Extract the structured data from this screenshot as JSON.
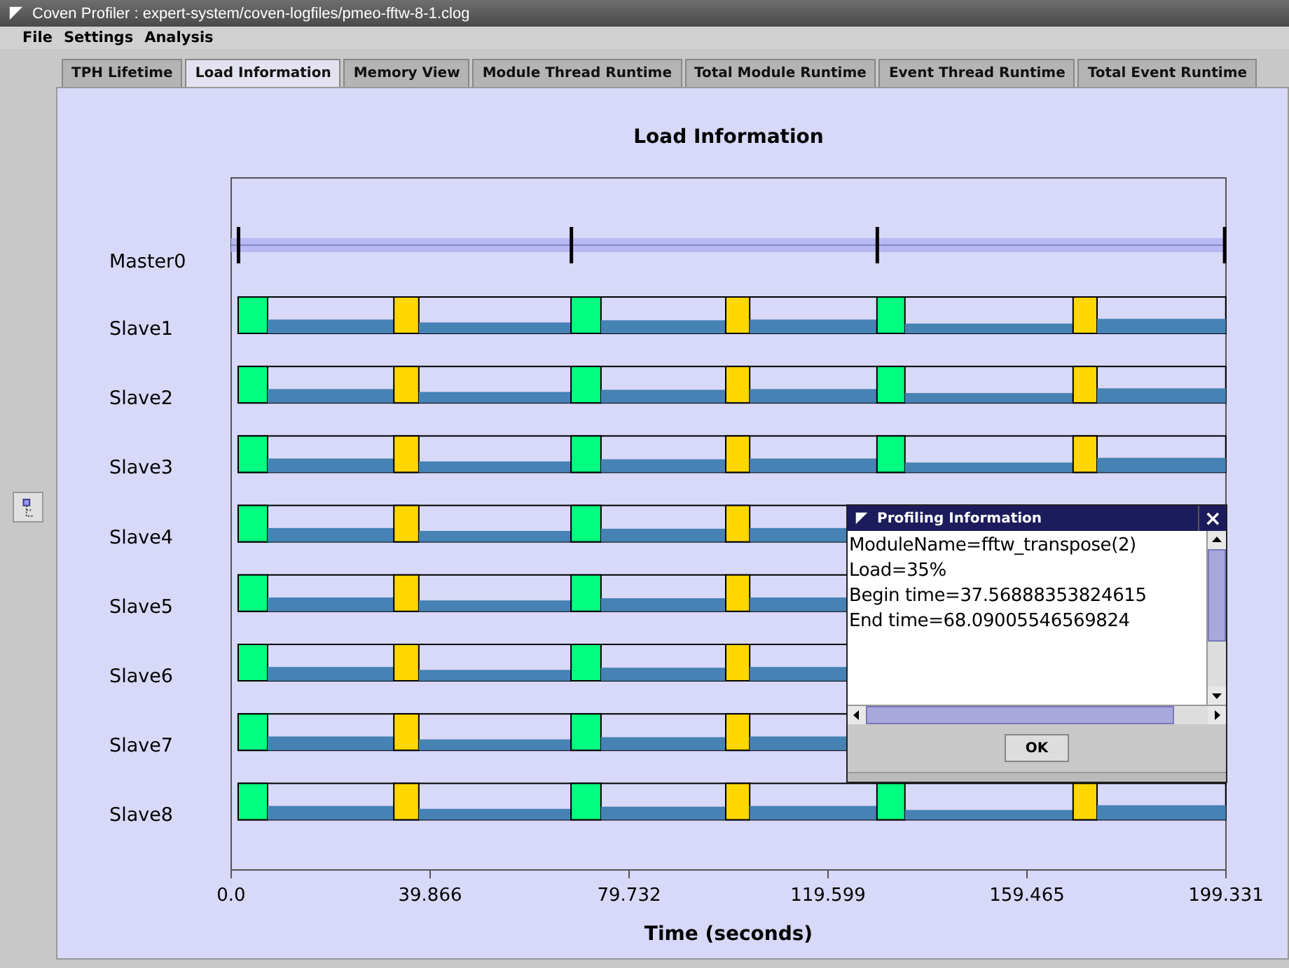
{
  "window": {
    "title": "Coven Profiler : expert-system/coven-logfiles/pmeo-fftw-8-1.clog"
  },
  "menu": [
    "File",
    "Settings",
    "Analysis"
  ],
  "tabs": [
    {
      "label": "TPH Lifetime",
      "selected": false
    },
    {
      "label": "Load Information",
      "selected": true
    },
    {
      "label": "Memory View",
      "selected": false
    },
    {
      "label": "Module Thread Runtime",
      "selected": false
    },
    {
      "label": "Total Module Runtime",
      "selected": false
    },
    {
      "label": "Event Thread Runtime",
      "selected": false
    },
    {
      "label": "Total Event Runtime",
      "selected": false
    }
  ],
  "chart": {
    "title": "Load Information",
    "xlabel": "Time (seconds)",
    "axis_labels": [
      "0.0",
      "39.866",
      "79.732",
      "119.599",
      "159.465",
      "199.331"
    ],
    "master": "Master0",
    "lanes": [
      "Slave1",
      "Slave2",
      "Slave3",
      "Slave4",
      "Slave5",
      "Slave6",
      "Slave7",
      "Slave8"
    ]
  },
  "popup": {
    "title": "Profiling Information",
    "close": "×",
    "lines": [
      "ModuleName=fftw_transpose(2)",
      "Load=35%",
      "Begin time=37.56888353824615",
      "End time=68.09005546569824"
    ],
    "button": "OK"
  }
}
